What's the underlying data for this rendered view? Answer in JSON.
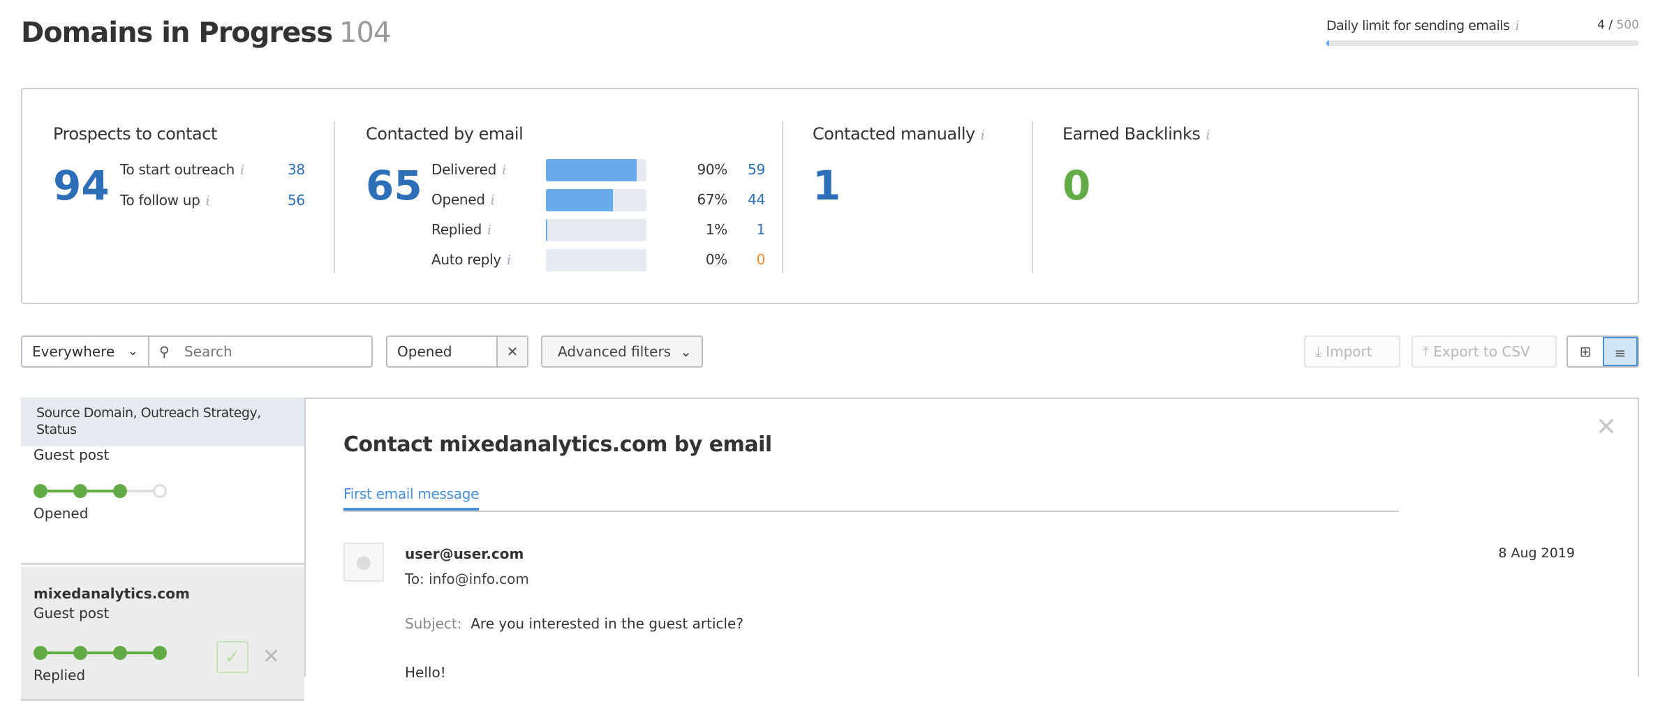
{
  "header": {
    "title": "Domains in Progress",
    "count": "104"
  },
  "daily_limit": {
    "label": "Daily limit for sending emails",
    "used": "4",
    "separator": " / ",
    "total": "500",
    "fill_fraction": 0.008
  },
  "stats": {
    "prospects": {
      "title": "Prospects to contact",
      "total": "94",
      "rows": [
        {
          "label": "To start outreach",
          "value": "38"
        },
        {
          "label": "To follow up",
          "value": "56"
        }
      ]
    },
    "email": {
      "title": "Contacted by email",
      "total": "65",
      "rows": [
        {
          "label": "Delivered",
          "percent": "90%",
          "value": "59",
          "fill": 0.9,
          "value_color": "#2c6fb7"
        },
        {
          "label": "Opened",
          "percent": "67%",
          "value": "44",
          "fill": 0.67,
          "value_color": "#2c6fb7"
        },
        {
          "label": "Replied",
          "percent": "1%",
          "value": "1",
          "fill": 0.01,
          "value_color": "#2c6fb7"
        },
        {
          "label": "Auto reply",
          "percent": "0%",
          "value": "0",
          "fill": 0,
          "value_color": "#f08a24"
        }
      ]
    },
    "manual": {
      "title": "Contacted manually",
      "total": "1"
    },
    "backlinks": {
      "title": "Earned Backlinks",
      "total": "0",
      "color": "#62ab46"
    }
  },
  "filters": {
    "scope": "Everywhere",
    "search_placeholder": "Search",
    "status_filter": "Opened",
    "advanced": "Advanced filters",
    "import": "Import",
    "export": "Export to CSV"
  },
  "list": {
    "header": "Source Domain, Outreach Strategy, Status",
    "items": [
      {
        "domain": "",
        "strategy": "Guest post",
        "status": "Opened",
        "steps_done": 3,
        "steps_total": 4
      },
      {
        "domain": "mixedanalytics.com",
        "strategy": "Guest post",
        "status": "Replied",
        "steps_done": 4,
        "steps_total": 4
      }
    ]
  },
  "panel": {
    "title": "Contact mixedanalytics.com by email",
    "tab": "First email message",
    "from": "user@user.com",
    "to": "To: info@info.com",
    "date": "8 Aug 2019",
    "subject_label": "Subject:",
    "subject": "Are you interested in the guest article?",
    "body_start": "Hello!"
  }
}
